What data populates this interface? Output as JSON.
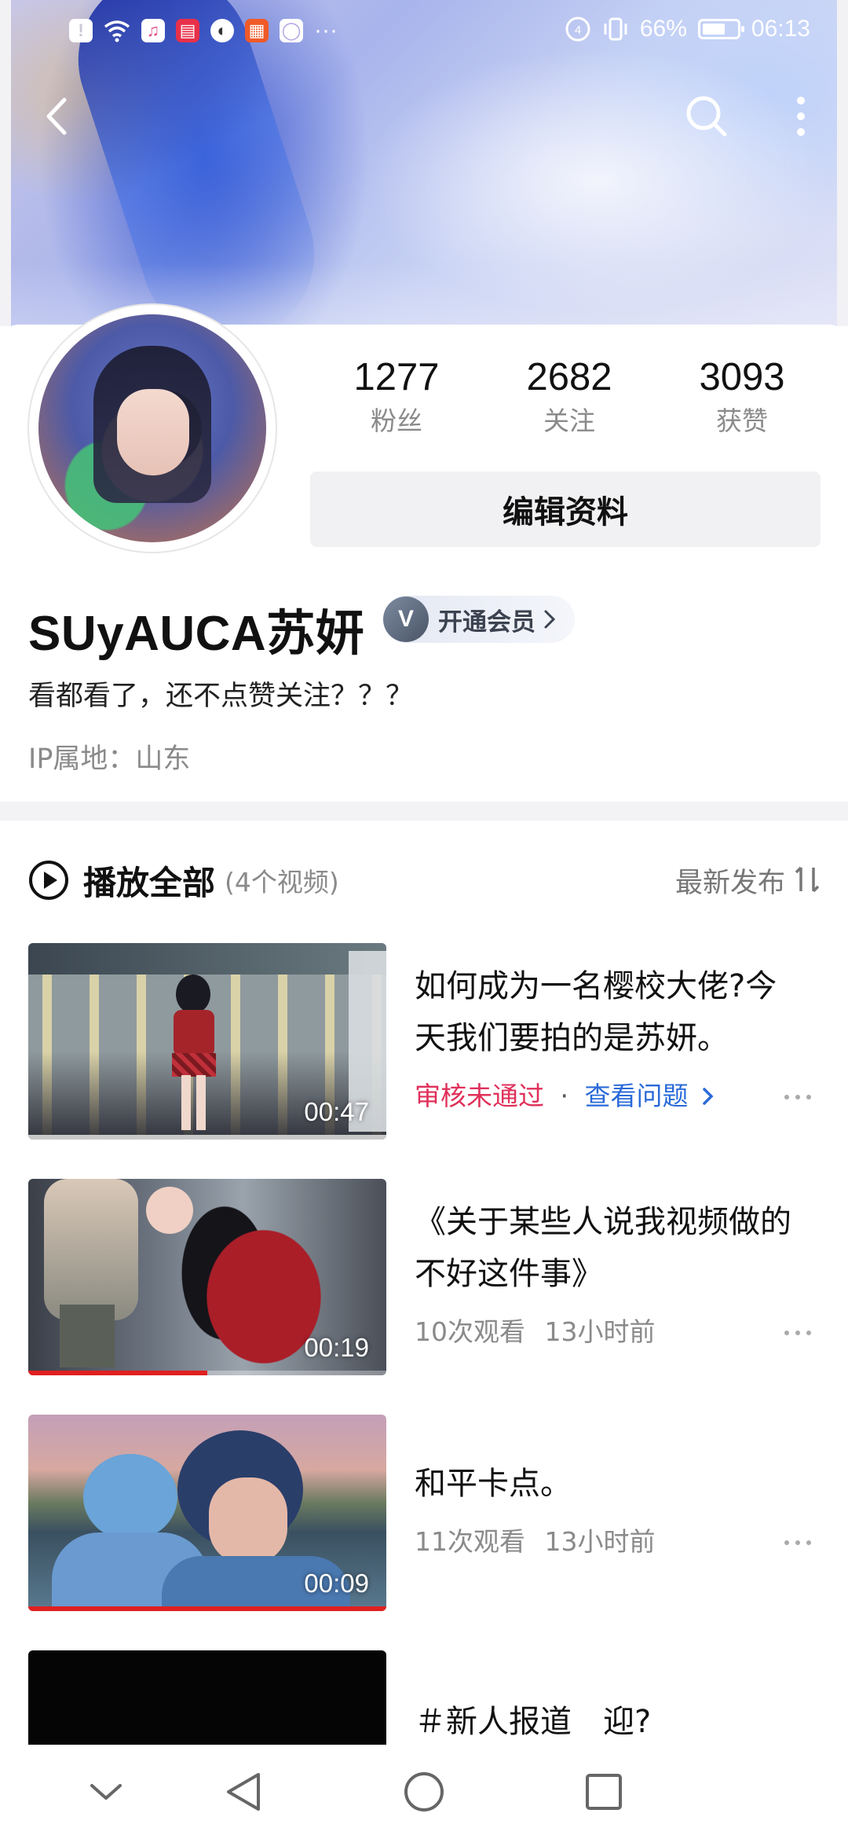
{
  "status_bar": {
    "battery_percent_text": "66%",
    "battery_level": 0.66,
    "time": "06:13",
    "more_indicator": "···"
  },
  "header": {
    "back_icon": "chevron-left-icon",
    "search_icon": "search-icon",
    "menu_icon": "more-vertical-icon"
  },
  "profile": {
    "stats": [
      {
        "value": "1277",
        "label": "粉丝"
      },
      {
        "value": "2682",
        "label": "关注"
      },
      {
        "value": "3093",
        "label": "获赞"
      }
    ],
    "edit_button": "编辑资料",
    "username": "SUyAUCA苏妍",
    "vip_badge_letter": "V",
    "vip_badge_text": "开通会员",
    "bio": "看都看了，还不点赞关注？？？",
    "ip_location": "IP属地：山东"
  },
  "video_list": {
    "title": "播放全部",
    "count": "(4个视频)",
    "sort_label": "最新发布",
    "videos": [
      {
        "title": "如何成为一名樱校大佬?今天我们要拍的是苏妍。",
        "duration": "00:47",
        "review_status": "审核未通过",
        "separator": "·",
        "review_action": "查看问题",
        "progress": 1.0
      },
      {
        "title": "《关于某些人说我视频做的不好这件事》",
        "duration": "00:19",
        "views": "10次观看",
        "time_ago": "13小时前",
        "progress": 0.5
      },
      {
        "title": "和平卡点。",
        "duration": "00:09",
        "views": "11次观看",
        "time_ago": "13小时前",
        "progress": 1.0
      },
      {
        "title": "＃新人报道　迎?"
      }
    ]
  },
  "colors": {
    "accent_red": "#e02020",
    "review_fail": "#e0305a",
    "link_blue": "#2a6ad8"
  }
}
